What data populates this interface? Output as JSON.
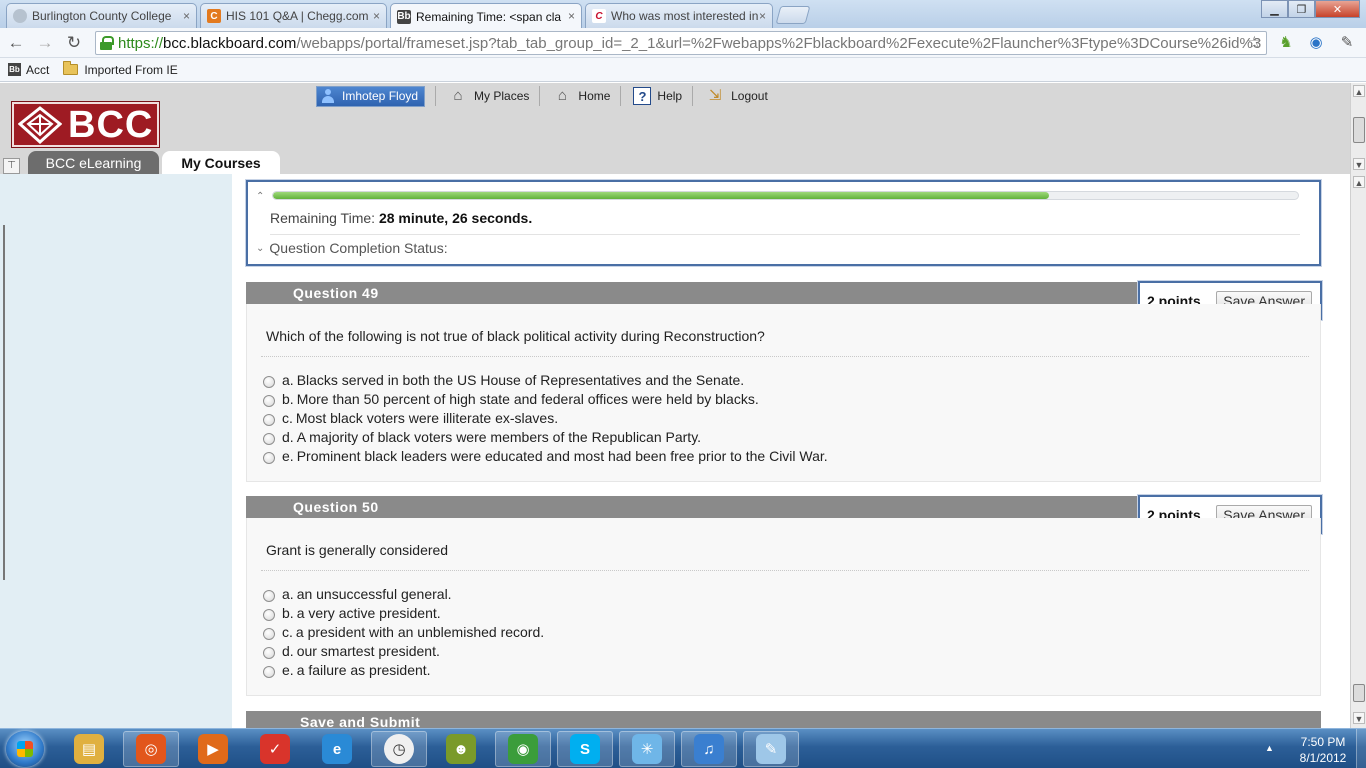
{
  "browser": {
    "tabs": [
      {
        "title": "Burlington County College",
        "favicon": "globe-icon",
        "color": "#9aa8b8"
      },
      {
        "title": "HIS 101 Q&A | Chegg.com",
        "favicon": "chegg-icon",
        "color": "#e37a1f"
      },
      {
        "title": "Remaining Time: <span cla",
        "favicon": "blackboard-icon",
        "color": "#444444"
      },
      {
        "title": "Who was most interested in",
        "favicon": "chacha-icon",
        "color": "#c8102e"
      }
    ],
    "url": {
      "scheme": "https://",
      "host": "bcc.blackboard.com",
      "path": "/webapps/portal/frameset.jsp?tab_tab_group_id=_2_1&url=%2Fwebapps%2Fblackboard%2Fexecute%2Flauncher%3Ftype%3DCourse%26id%3"
    },
    "bookmarks": [
      {
        "label": "Acct",
        "icon": "blackboard-icon"
      },
      {
        "label": "Imported From IE",
        "icon": "folder-icon"
      }
    ]
  },
  "header": {
    "logo_text": "BCC",
    "user_name": "Imhotep Floyd",
    "nav": {
      "my_places": "My Places",
      "home": "Home",
      "help": "Help",
      "logout": "Logout"
    },
    "course_tabs": {
      "elearning": "BCC eLearning",
      "my_courses": "My Courses"
    }
  },
  "timer": {
    "label": "Remaining Time:",
    "value": "28 minute, 26 seconds.",
    "progress_fraction": 0.757,
    "completion_label": "Question Completion Status:"
  },
  "questions": [
    {
      "title": "Question 49",
      "points": "2 points",
      "save_label": "Save Answer",
      "text": "Which of the following is not true of black political activity during Reconstruction?",
      "answers": [
        {
          "letter": "a.",
          "text": "Blacks served in both the US House of Representatives and the Senate."
        },
        {
          "letter": "b.",
          "text": "More than 50 percent of high state and federal offices were held by blacks."
        },
        {
          "letter": "c.",
          "text": "Most black voters were illiterate ex-slaves."
        },
        {
          "letter": "d.",
          "text": "A majority of black voters were members of the Republican Party."
        },
        {
          "letter": "e.",
          "text": "Prominent black leaders were educated and most had been free prior to the Civil War."
        }
      ]
    },
    {
      "title": "Question 50",
      "points": "2 points",
      "save_label": "Save Answer",
      "text": "Grant is generally considered",
      "answers": [
        {
          "letter": "a.",
          "text": "an unsuccessful general."
        },
        {
          "letter": "b.",
          "text": "a very active president."
        },
        {
          "letter": "c.",
          "text": "a president with an unblemished record."
        },
        {
          "letter": "d.",
          "text": "our smartest president."
        },
        {
          "letter": "e.",
          "text": "a failure as president."
        }
      ]
    }
  ],
  "submit_label": "Save and Submit",
  "taskbar": {
    "apps": [
      {
        "name": "explorer-icon",
        "color": "#e0b040"
      },
      {
        "name": "firefox-icon",
        "color": "#e2561c"
      },
      {
        "name": "media-player-icon",
        "color": "#e06a1a"
      },
      {
        "name": "todoist-icon",
        "color": "#d9342b"
      },
      {
        "name": "ie-icon",
        "color": "#2a8ad6"
      },
      {
        "name": "clock-icon",
        "color": "#f0f0f0"
      },
      {
        "name": "bonzi-icon",
        "color": "#7a9a2a"
      },
      {
        "name": "chrome-icon",
        "color": "#3b9d3b"
      },
      {
        "name": "skype-icon",
        "color": "#00aff0"
      },
      {
        "name": "network-icon",
        "color": "#6fb6e8"
      },
      {
        "name": "itunes-icon",
        "color": "#3a7fd0"
      },
      {
        "name": "paint-icon",
        "color": "#9ec7e8"
      }
    ],
    "time": "7:50 PM",
    "date": "8/1/2012"
  }
}
